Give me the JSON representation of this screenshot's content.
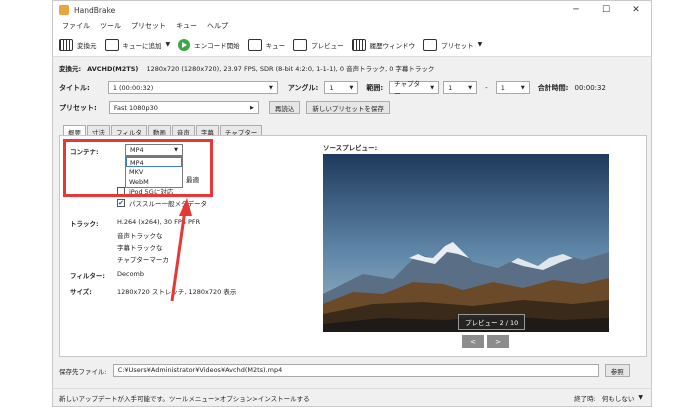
{
  "window": {
    "title": "HandBrake",
    "minimize": "─",
    "maximize": "☐",
    "close": "✕"
  },
  "menu": [
    "ファイル",
    "ツール",
    "プリセット",
    "キュー",
    "ヘルプ"
  ],
  "toolbar": {
    "source": "変換元",
    "add_queue": "キューに追加",
    "start": "エンコード開始",
    "queue": "キュー",
    "preview": "プレビュー",
    "activity": "履歴ウィンドウ",
    "presets": "プリセット"
  },
  "source": {
    "label": "変換元:",
    "name": "AVCHD(M2TS)",
    "info": "1280x720 (1280x720), 23.97 FPS, SDR (8-bit 4:2:0, 1-1-1), 0 音声トラック, 0 字幕トラック"
  },
  "title_row": {
    "label": "タイトル:",
    "title_value": "1 (00:00:32)",
    "angle_label": "アングル:",
    "angle_value": "1",
    "range_label": "範囲:",
    "range_type": "チャプター",
    "range_start": "1",
    "dash": "-",
    "range_end": "1",
    "duration_label": "合計時間:",
    "duration_value": "00:00:32"
  },
  "preset_row": {
    "label": "プリセット:",
    "value": "Fast 1080p30",
    "reload": "再読込",
    "save_new": "新しいプリセットを保存"
  },
  "tabs": [
    "概要",
    "寸法",
    "フィルタ",
    "動画",
    "音声",
    "字幕",
    "チャプター"
  ],
  "summary": {
    "container_label": "コンテナ:",
    "container_value": "MP4",
    "container_options": [
      "MP4",
      "MKV",
      "WebM"
    ],
    "web_optimized_partial": "最適",
    "ipod_label": "iPod 5Gに対応",
    "passthru_label": "パススルー一般メタデータ",
    "tracks_label": "トラック:",
    "tracks": [
      "H.264 (x264), 30 FPS PFR",
      "音声トラックな",
      "字幕トラックな",
      "チャプターマーカ"
    ],
    "filters_label": "フィルター:",
    "filters_value": "Decomb",
    "size_label": "サイズ:",
    "size_value": "1280x720 ストレッチ, 1280x720 表示"
  },
  "preview": {
    "label": "ソースプレビュー:",
    "page": "プレビュー 2 / 10",
    "prev": "<",
    "next": ">"
  },
  "save": {
    "label": "保存先ファイル:",
    "path": "C:¥Users¥Administrator¥Videos¥Avchd(M2ts).mp4",
    "browse": "参照"
  },
  "status": {
    "message": "新しいアップデートが入手可能です。ツールメニュー>オプション>インストールする",
    "when_done_label": "終了時:",
    "when_done_value": "何もしない"
  },
  "colors": {
    "highlight": "#e53935",
    "start_icon": "#3aa847"
  }
}
